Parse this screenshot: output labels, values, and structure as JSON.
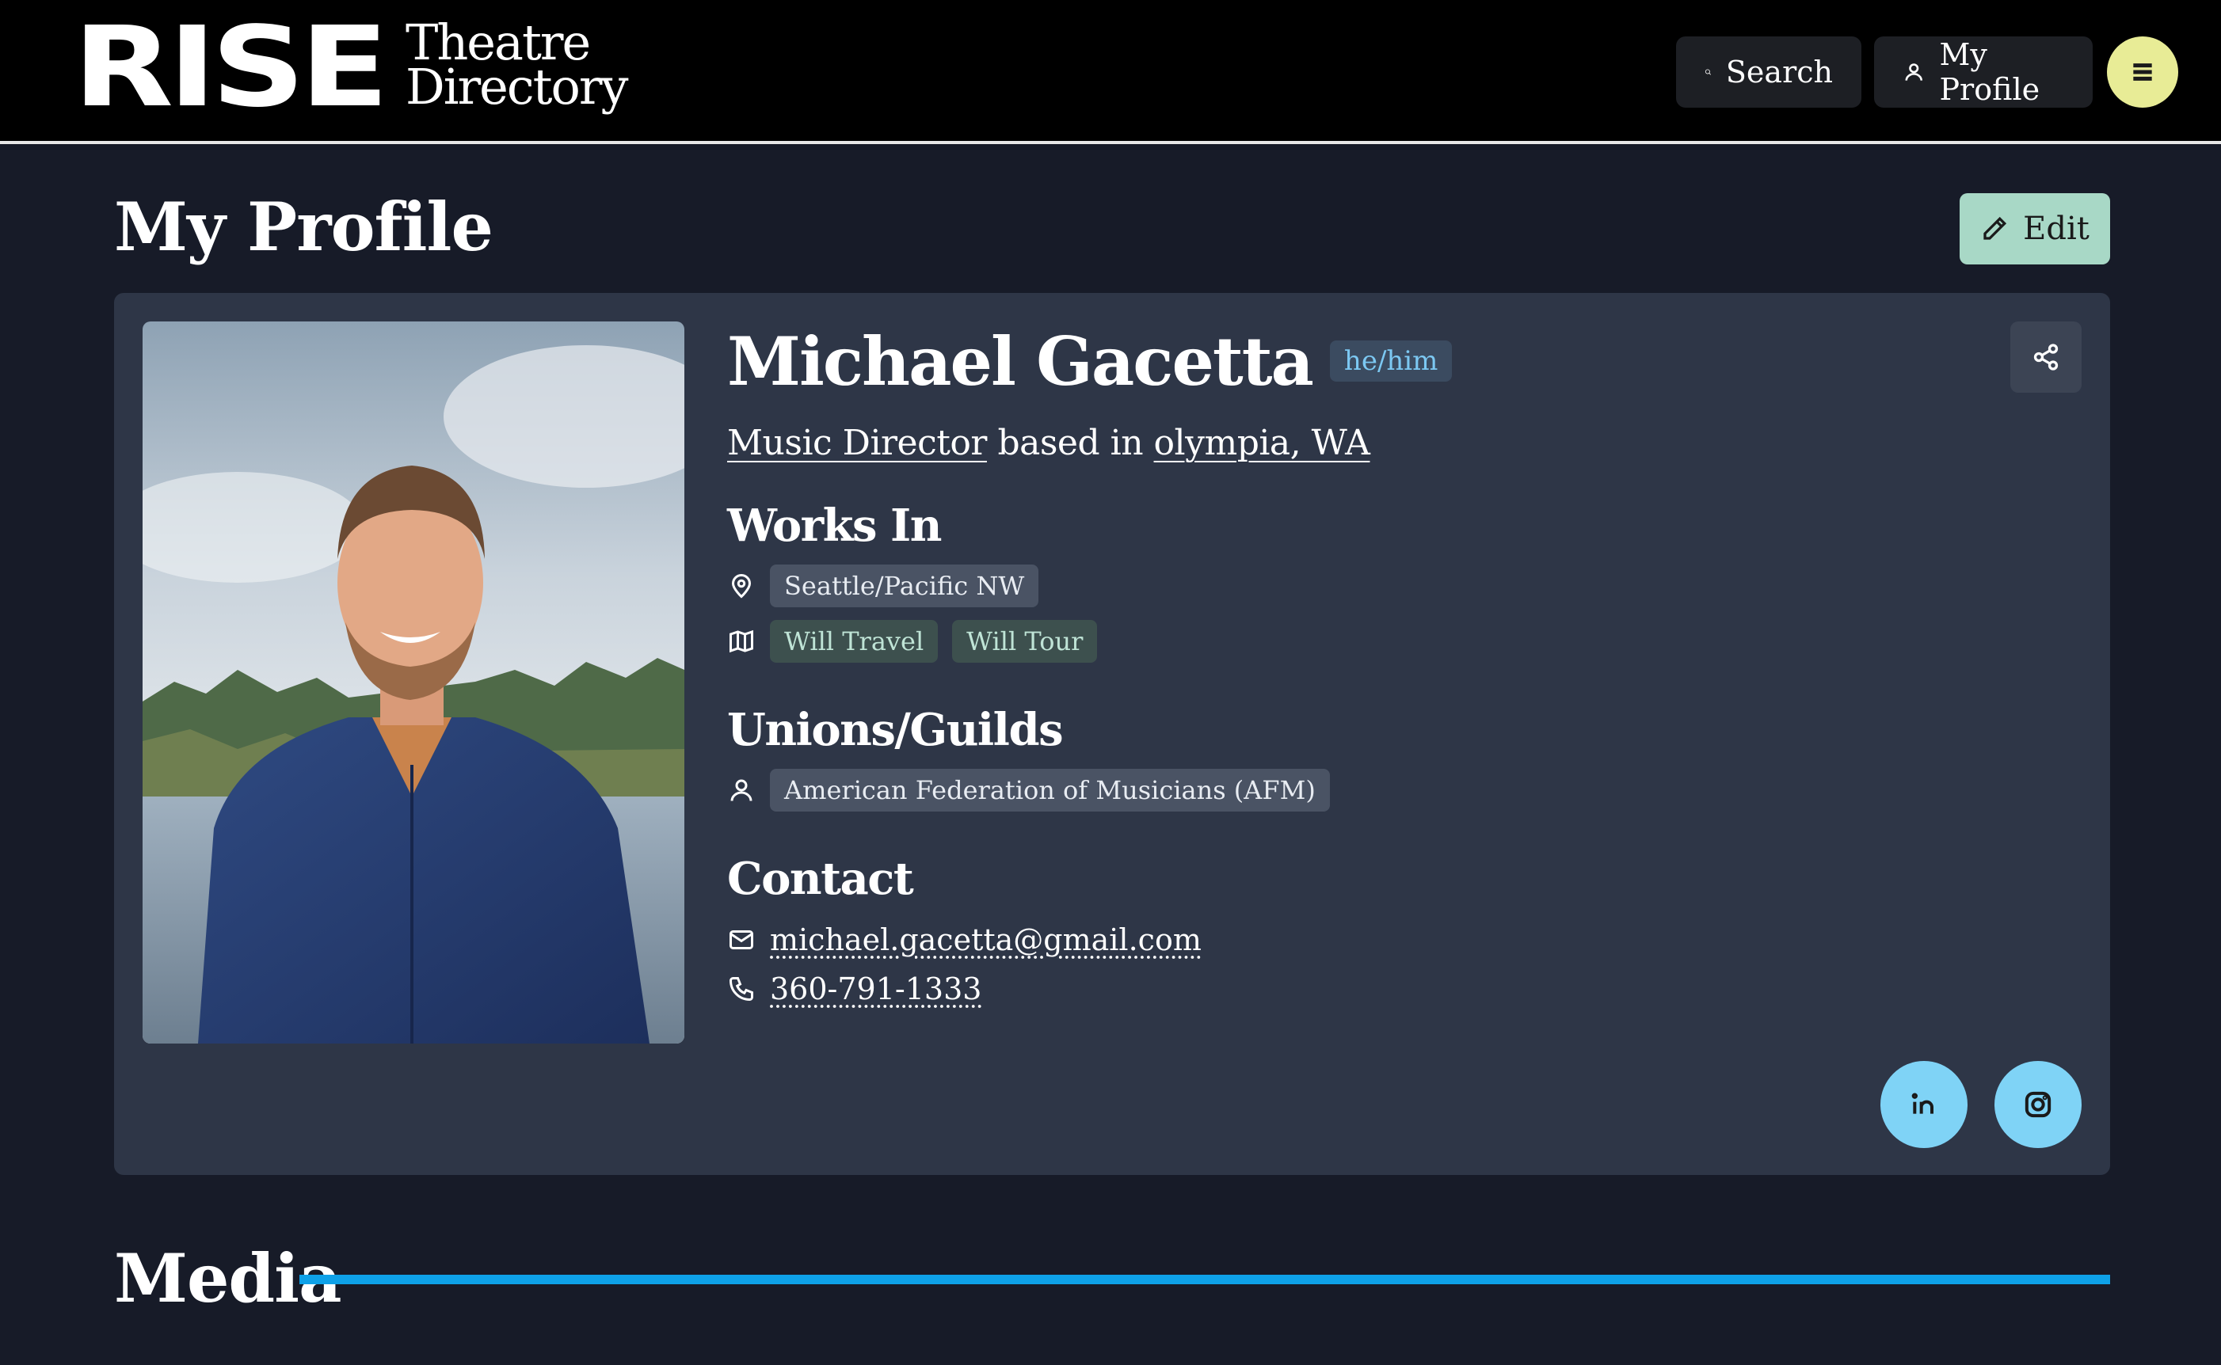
{
  "header": {
    "logo_main": "RISE",
    "logo_sub_line1": "Theatre",
    "logo_sub_line2": "Directory",
    "search_label": "Search",
    "profile_label": "My Profile"
  },
  "page": {
    "title": "My Profile",
    "edit_label": "Edit"
  },
  "profile": {
    "name": "Michael Gacetta",
    "pronouns": "he/him",
    "role": "Music Director",
    "based_in_text": "based in",
    "location": "olympia, WA",
    "works_in": {
      "heading": "Works In",
      "region": "Seattle/Pacific NW",
      "travel": [
        "Will Travel",
        "Will Tour"
      ]
    },
    "unions": {
      "heading": "Unions/Guilds",
      "items": [
        "American Federation of Musicians (AFM)"
      ]
    },
    "contact": {
      "heading": "Contact",
      "email": "michael.gacetta@gmail.com",
      "phone": "360-791-1333"
    },
    "social": [
      "linkedin-icon",
      "instagram-icon"
    ]
  },
  "media": {
    "title": "Media"
  },
  "colors": {
    "page_bg": "#171b28",
    "card_bg": "#2e3647",
    "accent_yellow": "#e8ec96",
    "edit_green": "#a8d8c6",
    "social_blue": "#7fd3f6",
    "rule_blue": "#0ea1e8",
    "pronoun_text": "#7cc8f2"
  }
}
